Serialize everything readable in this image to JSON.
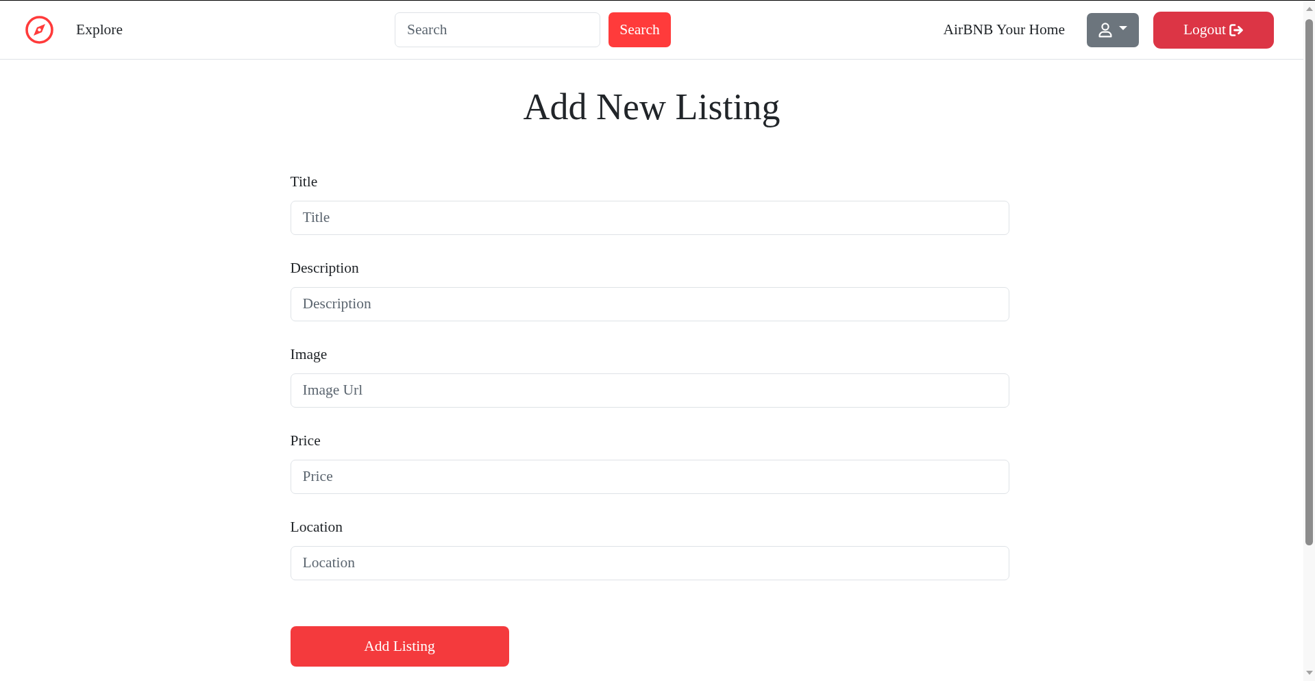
{
  "navbar": {
    "brand_link": "Explore",
    "search": {
      "placeholder": "Search",
      "button": "Search"
    },
    "site_link": "AirBNB Your Home",
    "logout_button": "Logout"
  },
  "form": {
    "heading": "Add New Listing",
    "fields": [
      {
        "label": "Title",
        "placeholder": "Title"
      },
      {
        "label": "Description",
        "placeholder": "Description"
      },
      {
        "label": "Image",
        "placeholder": "Image Url"
      },
      {
        "label": "Price",
        "placeholder": "Price"
      },
      {
        "label": "Location",
        "placeholder": "Location"
      }
    ],
    "submit_button": "Add Listing"
  }
}
